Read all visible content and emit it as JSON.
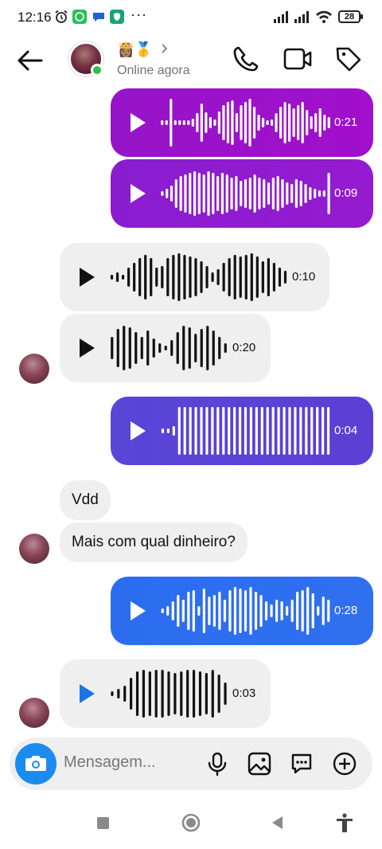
{
  "status_bar": {
    "time": "12:16",
    "more": "···",
    "battery": "28",
    "icons": [
      "alarm-icon",
      "whatsapp-icon",
      "chat-icon",
      "shield-icon",
      "signal-icon",
      "signal-icon",
      "wifi-icon",
      "battery-icon"
    ]
  },
  "header": {
    "name": "👸🏽🥇",
    "status": "Online agora",
    "icons": [
      "back-arrow-icon",
      "avatar",
      "chevron-right-icon",
      "phone-icon",
      "video-icon",
      "tag-icon"
    ]
  },
  "messages": [
    {
      "type": "voice",
      "direction": "out",
      "duration": "0:21",
      "color": "#9a17c9"
    },
    {
      "type": "voice",
      "direction": "out",
      "duration": "0:09",
      "color": "#8b1fd0"
    },
    {
      "type": "voice",
      "direction": "in",
      "duration": "0:10"
    },
    {
      "type": "voice",
      "direction": "in",
      "duration": "0:20"
    },
    {
      "type": "voice",
      "direction": "out",
      "duration": "0:04",
      "color": "#5a41d6"
    },
    {
      "type": "text",
      "direction": "in",
      "text": "Vdd"
    },
    {
      "type": "text",
      "direction": "in",
      "text": "Mais com qual dinheiro?"
    },
    {
      "type": "voice",
      "direction": "out",
      "duration": "0:28",
      "color": "#2e6ff0"
    },
    {
      "type": "voice",
      "direction": "in",
      "duration": "0:03",
      "play_color": "#1a74e8"
    }
  ],
  "composer": {
    "placeholder": "Mensagem...",
    "camera_color": "#1a8cf0",
    "icons": [
      "camera-icon",
      "microphone-icon",
      "image-icon",
      "sticker-chat-icon",
      "add-circle-icon"
    ]
  },
  "nav_bar": {
    "icons": [
      "recents-square-icon",
      "home-circle-icon",
      "back-triangle-icon",
      "accessibility-icon"
    ]
  }
}
